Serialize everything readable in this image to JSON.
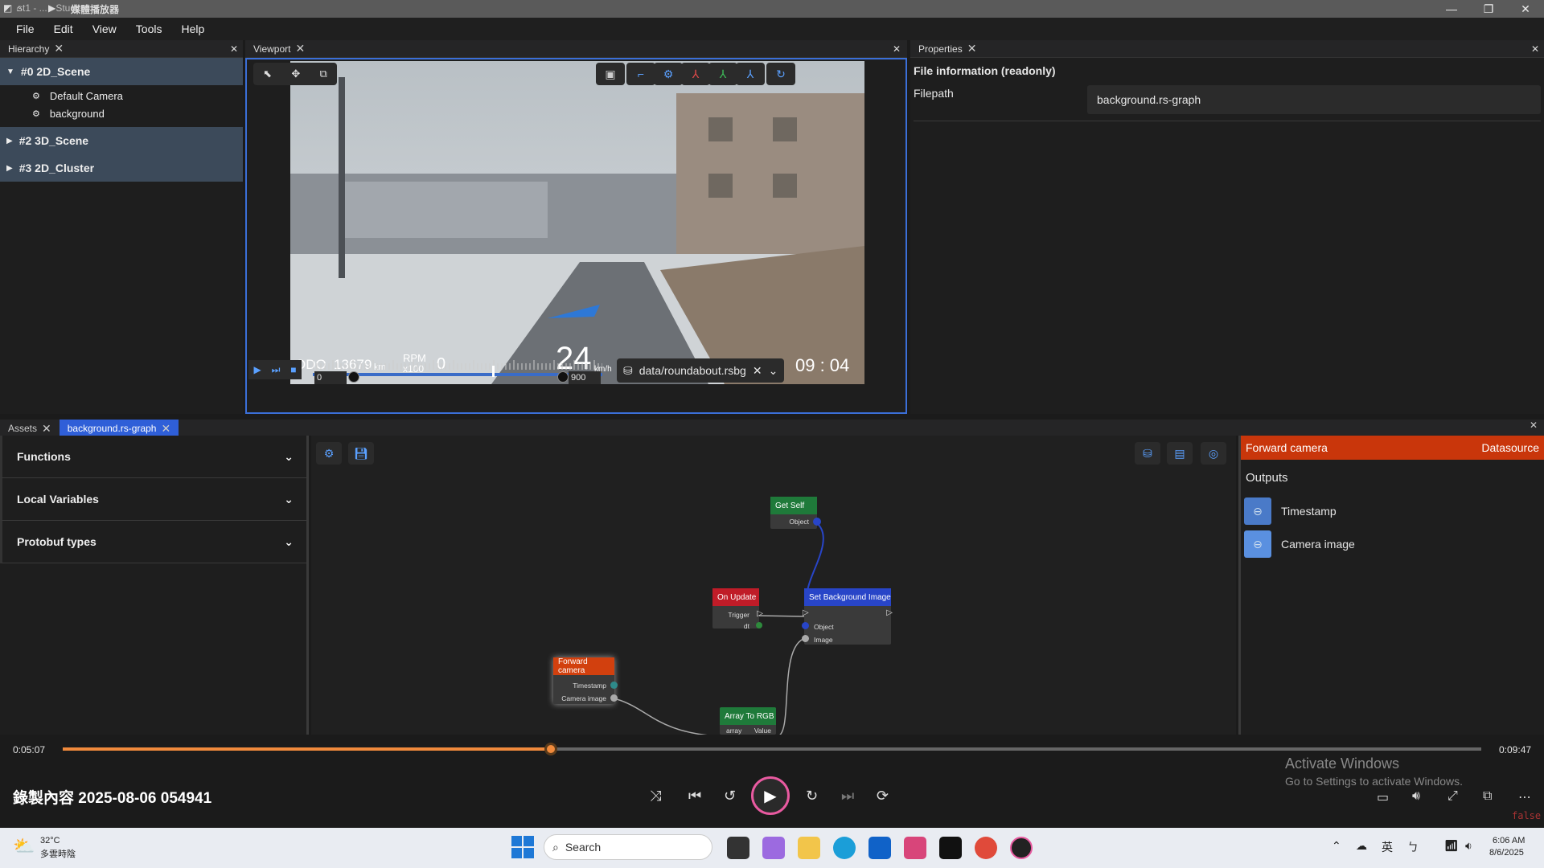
{
  "window": {
    "title": "st1 - ... - Studio",
    "overlay_title": "媒體播放器"
  },
  "menu": [
    "File",
    "Edit",
    "View",
    "Tools",
    "Help"
  ],
  "hierarchy": {
    "tab": "Hierarchy",
    "scenes": [
      {
        "label": "#0 2D_Scene",
        "expanded": true,
        "children": [
          "Default Camera",
          "background"
        ]
      },
      {
        "label": "#2 3D_Scene",
        "expanded": false
      },
      {
        "label": "#3 2D_Cluster",
        "expanded": false
      }
    ]
  },
  "viewport": {
    "tab": "Viewport",
    "hud": {
      "odo_label": "ODO",
      "odo_value": "13679",
      "odo_unit": "km",
      "rpm_label": "RPM",
      "rpm_mult": "x100",
      "rpm_value": "0",
      "speed": "24",
      "speed_unit": "km/h",
      "time": "09 : 04"
    },
    "timeline": {
      "start": "0",
      "end": "900",
      "playhead_fraction": 0.62
    },
    "datasource": "data/roundabout.rsbg"
  },
  "properties": {
    "tab": "Properties",
    "section": "File information (readonly)",
    "filepath_label": "Filepath",
    "filepath_value": "background.rs-graph"
  },
  "bottom_tabs": [
    "Assets",
    "background.rs-graph"
  ],
  "left_panel": {
    "sections": [
      "Functions",
      "Local Variables",
      "Protobuf types"
    ]
  },
  "graph": {
    "nodes": {
      "get_self": {
        "title": "Get Self",
        "ports": [
          "Object"
        ],
        "color": "#1f7a3a"
      },
      "on_update": {
        "title": "On Update",
        "ports": [
          "Trigger",
          "dt"
        ],
        "color": "#c01c28"
      },
      "set_bg": {
        "title": "Set Background Image",
        "ports": [
          "Object",
          "Image"
        ],
        "color": "#2845c8"
      },
      "forward_camera": {
        "title": "Forward camera",
        "ports": [
          "Timestamp",
          "Camera image"
        ],
        "color": "#d2400e"
      },
      "array_to_rgb": {
        "title": "Array To RGB",
        "ports": [
          "array",
          "Value"
        ],
        "color": "#1f7a3a"
      }
    }
  },
  "right_panel": {
    "title": "Forward camera",
    "badge": "Datasource",
    "outputs_label": "Outputs",
    "outputs": [
      "Timestamp",
      "Camera image"
    ]
  },
  "media_player": {
    "current_time": "0:05:07",
    "total_time": "0:09:47",
    "progress_fraction": 0.344,
    "title": "錄製內容 2025-08-06 054941",
    "activate_title": "Activate Windows",
    "activate_sub": "Go to Settings to activate Windows.",
    "corner_text": "false"
  },
  "taskbar": {
    "weather_temp": "32°C",
    "weather_desc": "多雲時陰",
    "search_placeholder": "Search",
    "ime": "英",
    "time": "6:06 AM",
    "date": "8/6/2025"
  }
}
